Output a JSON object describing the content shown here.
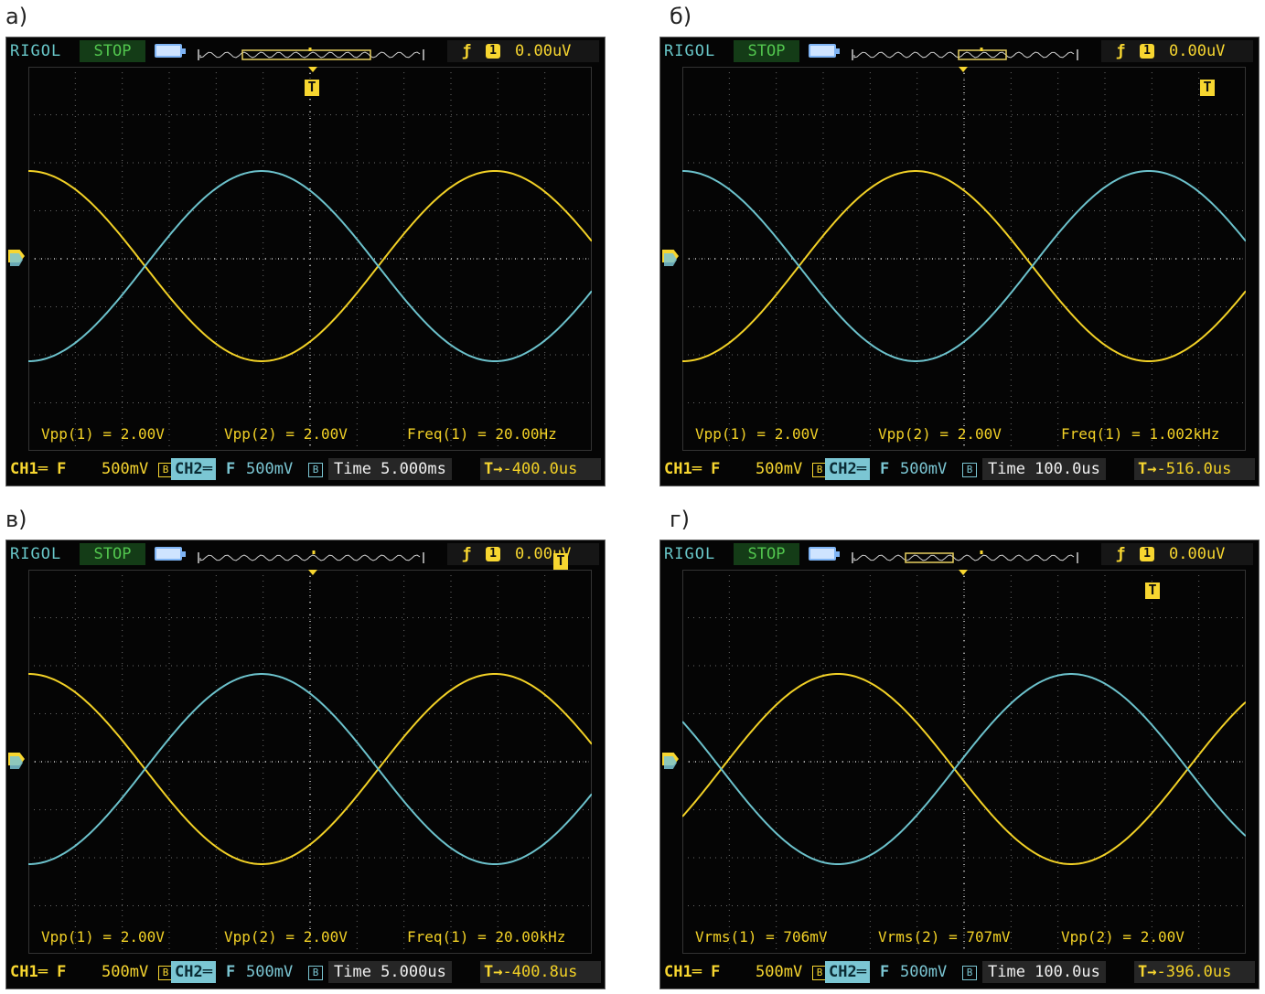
{
  "panels": [
    {
      "letter": "а)",
      "brand": "RIGOL",
      "status": "STOP",
      "trigger": {
        "edge_icon": "rising-edge-icon",
        "edge_glyph": "ƒ",
        "source": "1",
        "level": "0.00uV"
      },
      "bottom": {
        "ch1": "CH1═ F",
        "ch1_scale": "500mV",
        "ch2": "CH2═",
        "ch2_f": "F",
        "ch2_scale": "500mV",
        "bw": "B",
        "timebase": "Time 5.000ms",
        "trig_delay": "-400.0us"
      },
      "measurements": [
        {
          "text": "Vpp(1) = 2.00V"
        },
        {
          "text": "Vpp(2) = 2.00V"
        },
        {
          "text": "Freq(1) = 20.00Hz"
        }
      ],
      "signal": {
        "ch1_phase_deg": 90,
        "ch2_phase_deg": -90
      }
    },
    {
      "letter": "б)",
      "brand": "RIGOL",
      "status": "STOP",
      "trigger": {
        "edge_icon": "rising-edge-icon",
        "edge_glyph": "ƒ",
        "source": "1",
        "level": "0.00uV"
      },
      "bottom": {
        "ch1": "CH1═ F",
        "ch1_scale": "500mV",
        "ch2": "CH2═",
        "ch2_f": "F",
        "ch2_scale": "500mV",
        "bw": "B",
        "timebase": "Time 100.0us",
        "trig_delay": "-516.0us"
      },
      "measurements": [
        {
          "text": "Vpp(1) = 2.00V"
        },
        {
          "text": "Vpp(2) = 2.00V"
        },
        {
          "text": "Freq(1) = 1.002kHz"
        }
      ],
      "signal": {
        "ch1_phase_deg": -90,
        "ch2_phase_deg": 90
      }
    },
    {
      "letter": "в)",
      "brand": "RIGOL",
      "status": "STOP",
      "trigger": {
        "edge_icon": "rising-edge-icon",
        "edge_glyph": "ƒ",
        "source": "1",
        "level": "0.00uV"
      },
      "bottom": {
        "ch1": "CH1═ F",
        "ch1_scale": "500mV",
        "ch2": "CH2═",
        "ch2_f": "F",
        "ch2_scale": "500mV",
        "bw": "B",
        "timebase": "Time 5.000us",
        "trig_delay": "-400.8us"
      },
      "measurements": [
        {
          "text": "Vpp(1) = 2.00V"
        },
        {
          "text": "Vpp(2) = 2.00V"
        },
        {
          "text": "Freq(1) = 20.00kHz"
        }
      ],
      "signal": {
        "ch1_phase_deg": 90,
        "ch2_phase_deg": -90
      }
    },
    {
      "letter": "г)",
      "brand": "RIGOL",
      "status": "STOP",
      "trigger": {
        "edge_icon": "rising-edge-icon",
        "edge_glyph": "ƒ",
        "source": "1",
        "level": "0.00uV"
      },
      "bottom": {
        "ch1": "CH1═ F",
        "ch1_scale": "500mV",
        "ch2": "CH2═",
        "ch2_f": "F",
        "ch2_scale": "500mV",
        "bw": "B",
        "timebase": "Time 100.0us",
        "trig_delay": "-396.0us"
      },
      "measurements": [
        {
          "text": "Vrms(1) = 706mV"
        },
        {
          "text": "Vrms(2) = 707mV"
        },
        {
          "text": "Vpp(2) = 2.00V"
        }
      ],
      "signal": {
        "ch1_phase_deg": -30,
        "ch2_phase_deg": 150
      }
    }
  ],
  "colors": {
    "ch1": "#f2d126",
    "ch2": "#6cc2cc",
    "grid": "#6a6a6a",
    "bg": "#050505"
  }
}
